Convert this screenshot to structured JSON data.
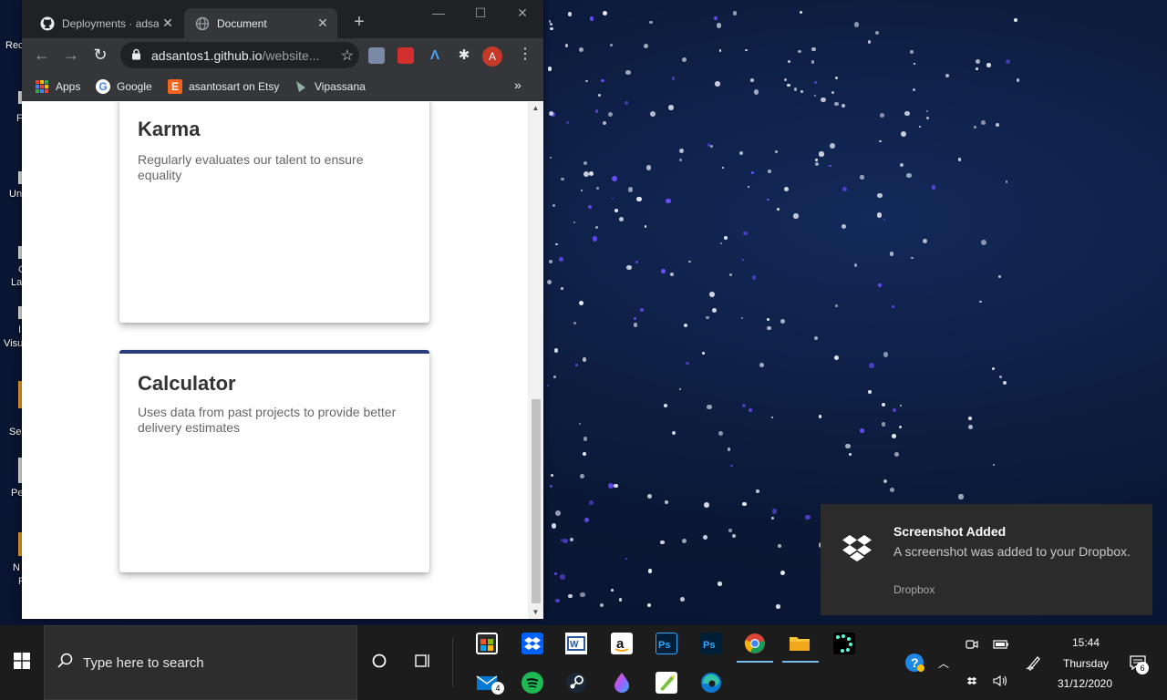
{
  "browser": {
    "tabs": [
      {
        "title": "Deployments · adsa",
        "icon": "github-icon",
        "active": false
      },
      {
        "title": "Document",
        "icon": "globe-icon",
        "active": true
      }
    ],
    "address": {
      "host": "adsantos1.github.io",
      "path": "/website..."
    },
    "profile_initial": "A",
    "bookmarks": [
      {
        "label": "Apps",
        "icon": "apps-grid-icon"
      },
      {
        "label": "Google",
        "icon": "google-icon"
      },
      {
        "label": "asantosart on Etsy",
        "icon": "etsy-icon"
      },
      {
        "label": "Vipassana",
        "icon": "vipassana-icon"
      }
    ]
  },
  "page": {
    "cards": [
      {
        "title": "Karma",
        "description": "Regularly evaluates our talent to ensure equality",
        "accent": "#c8c400"
      },
      {
        "title": "Calculator",
        "description": "Uses data from past projects to provide better delivery estimates",
        "accent": "#2c3e7a"
      }
    ]
  },
  "notification": {
    "title": "Screenshot Added",
    "body": "A screenshot was added to your Dropbox.",
    "app": "Dropbox"
  },
  "taskbar": {
    "search_placeholder": "Type here to search",
    "mail_badge": "4",
    "notification_badge": "6",
    "time": "15:44",
    "day": "Thursday",
    "date": "31/12/2020"
  },
  "desktop": {
    "labels": [
      "Rec",
      "F",
      "Un",
      "C",
      "La",
      "I",
      "Visu",
      "Se",
      "Pe",
      "N",
      "F"
    ]
  }
}
